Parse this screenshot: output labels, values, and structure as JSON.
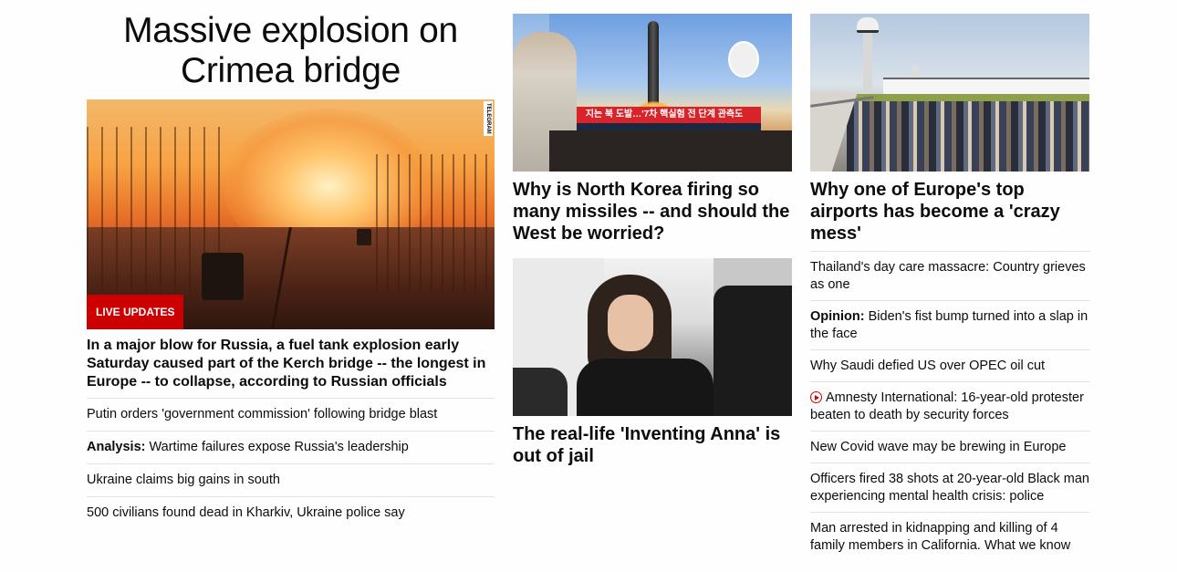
{
  "colors": {
    "accent": "#cc0000",
    "text": "#0c0c0c",
    "divider": "#e2e2e2"
  },
  "col1": {
    "headline": "Massive explosion on Crimea bridge",
    "hero_image_icon": "bridge-explosion-photo",
    "watermark": "TELEGRAM",
    "badge": "LIVE UPDATES",
    "lead": "In a major blow for Russia, a fuel tank explosion early Saturday caused part of the Kerch bridge -- the longest in Europe -- to collapse, according to Russian officials",
    "links": [
      {
        "prefix": "",
        "text": "Putin orders 'government commission' following bridge blast"
      },
      {
        "prefix": "Analysis:",
        "text": " Wartime failures expose Russia's leadership"
      },
      {
        "prefix": "",
        "text": "Ukraine claims big gains in south"
      },
      {
        "prefix": "",
        "text": "500 civilians found dead in Kharkiv, Ukraine police say"
      }
    ]
  },
  "col2": {
    "card1": {
      "image_icon": "missile-tv-broadcast-photo",
      "tv_banner": "지는 북 도발…'7차 핵실험 전 단계 관측도",
      "title": "Why is North Korea firing so many missiles -- and should the West be worried?"
    },
    "card2": {
      "image_icon": "courtroom-woman-photo",
      "title": "The real-life 'Inventing Anna' is out of jail"
    }
  },
  "col3": {
    "card": {
      "image_icon": "airport-crowd-photo",
      "title": "Why one of Europe's top airports has become a 'crazy mess'"
    },
    "links": [
      {
        "prefix": "",
        "video": false,
        "text": "Thailand's day care massacre: Country grieves as one"
      },
      {
        "prefix": "Opinion:",
        "video": false,
        "text": " Biden's fist bump turned into a slap in the face"
      },
      {
        "prefix": "",
        "video": false,
        "text": "Why Saudi defied US over OPEC oil cut"
      },
      {
        "prefix": "",
        "video": true,
        "text": "Amnesty International: 16-year-old protester beaten to death by security forces"
      },
      {
        "prefix": "",
        "video": false,
        "text": "New Covid wave may be brewing in Europe"
      },
      {
        "prefix": "",
        "video": false,
        "text": "Officers fired 38 shots at 20-year-old Black man experiencing mental health crisis: police"
      },
      {
        "prefix": "",
        "video": false,
        "text": "Man arrested in kidnapping and killing of 4 family members in California. What we know"
      }
    ]
  }
}
